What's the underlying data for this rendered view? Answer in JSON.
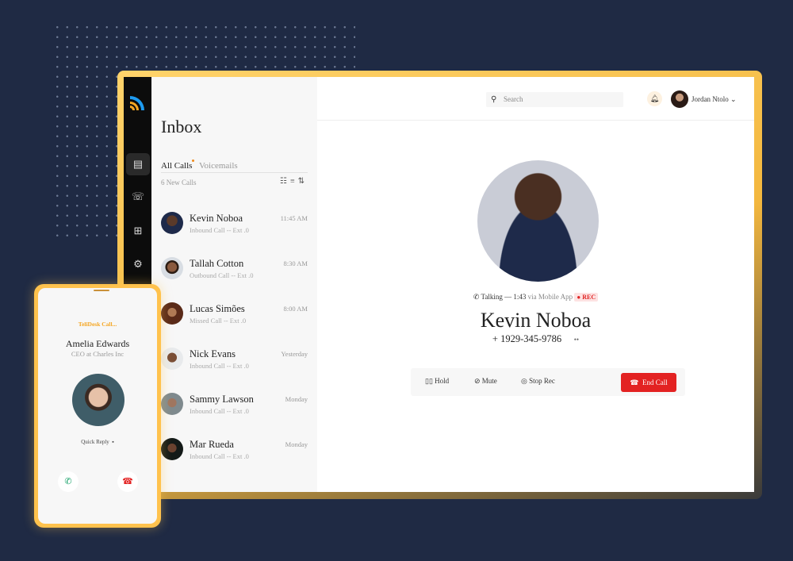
{
  "sidebar": {
    "items": [
      {
        "icon": "inbox-icon",
        "active": true
      },
      {
        "icon": "phone-transfer-icon"
      },
      {
        "icon": "network-icon"
      },
      {
        "icon": "gear-icon"
      }
    ]
  },
  "inbox": {
    "title": "Inbox",
    "tabs": [
      "All Calls",
      "Voicemails"
    ],
    "new_calls": "6 New Calls",
    "items": [
      {
        "name": "Kevin Noboa",
        "sub": "Inbound Call -- Ext .0",
        "time": "11:45 AM"
      },
      {
        "name": "Tallah Cotton",
        "sub": "Outbound Call -- Ext .0",
        "time": "8:30 AM"
      },
      {
        "name": "Lucas Simões",
        "sub": "Missed Call -- Ext .0",
        "time": "8:00 AM"
      },
      {
        "name": "Nick Evans",
        "sub": "Inbound Call -- Ext .0",
        "time": "Yesterday"
      },
      {
        "name": "Sammy Lawson",
        "sub": "Inbound Call -- Ext .0",
        "time": "Monday"
      },
      {
        "name": "Mar Rueda",
        "sub": "Inbound Call -- Ext .0",
        "time": "Monday"
      }
    ]
  },
  "header": {
    "search_placeholder": "Search",
    "user": "Jordan Ntolo"
  },
  "call": {
    "status": "Talking — 1:43",
    "via": "via Mobile App",
    "rec": "REC",
    "name": "Kevin Noboa",
    "phone": "+ 1929-345-9786",
    "more": "••",
    "actions": {
      "hold": "Hold",
      "mute": "Mute",
      "stop_rec": "Stop Rec",
      "end": "End Call"
    }
  },
  "mobile": {
    "title": "TeliDesk Call...",
    "name": "Amelia Edwards",
    "role": "CEO at Charles Inc",
    "quick_reply": "Quick Reply"
  },
  "colors": {
    "accent": "#ffc24d",
    "end_call": "#e32222",
    "background": "#1f2a44"
  }
}
